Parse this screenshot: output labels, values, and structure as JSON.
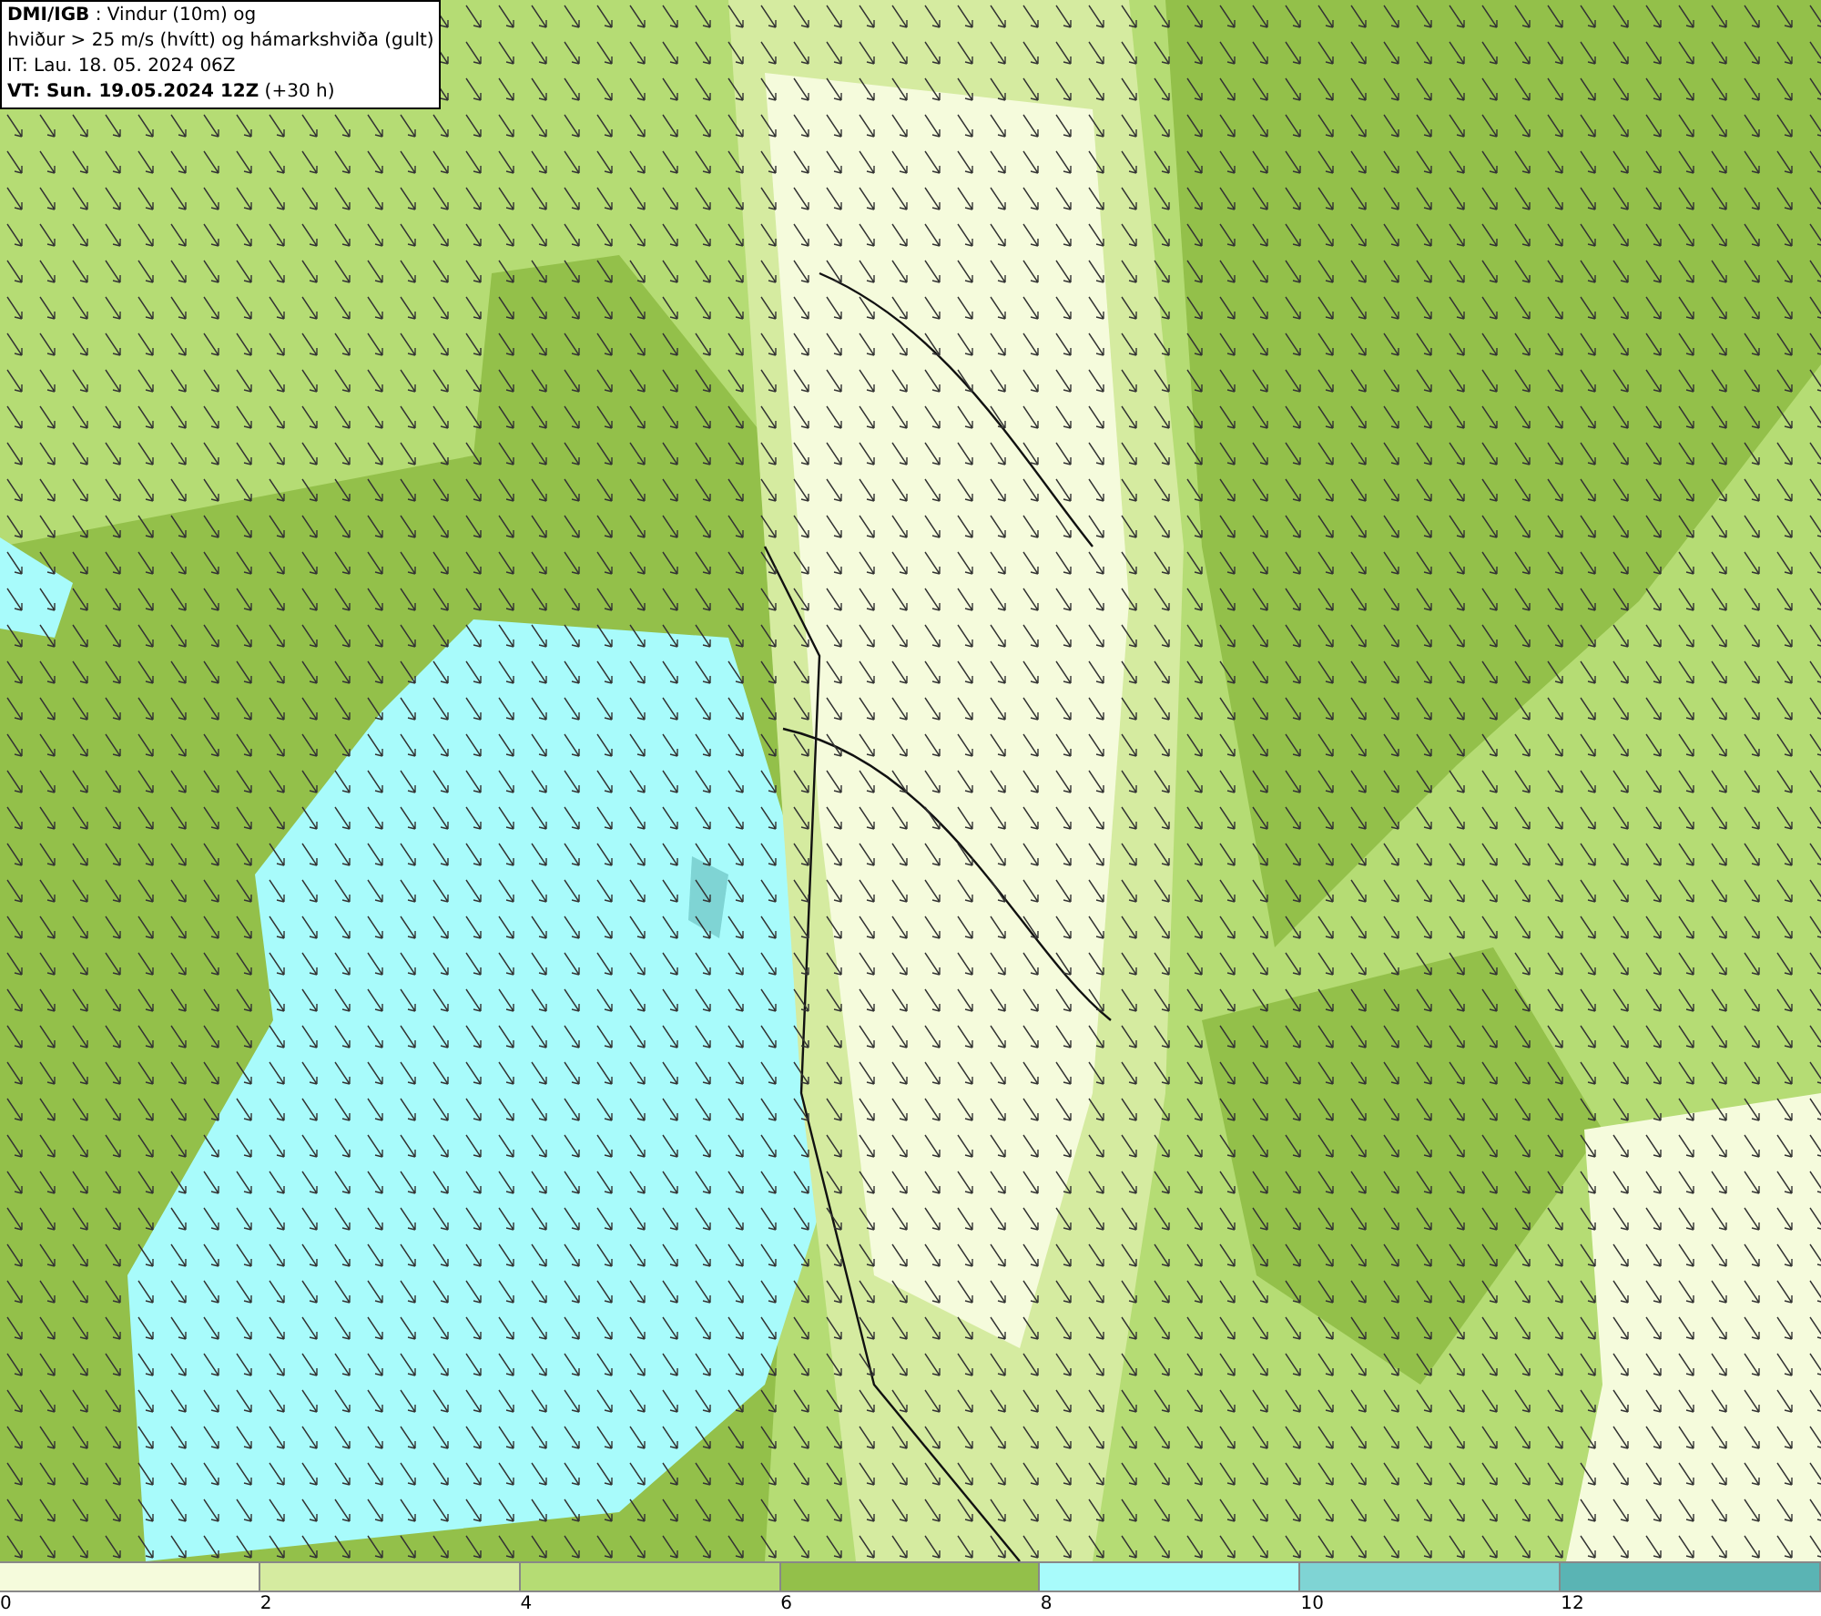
{
  "legend": {
    "lines": [
      "**DMI/IGB** : Vindur (10m) og",
      "hviður > 25 m/s (hvítt) og hámarkshviða (gult)",
      "IT: Lau. 18. 05. 2024 06Z",
      "**VT: Sun. 19.05.2024 12Z** (+30 h)"
    ]
  },
  "colorbar": [
    {
      "label": "0",
      "color": "#f5fbdc"
    },
    {
      "label": "2",
      "color": "#d5eba0"
    },
    {
      "label": "4",
      "color": "#b5dc74"
    },
    {
      "label": "6",
      "color": "#93c04a"
    },
    {
      "label": "8",
      "color": "#a8fbfb"
    },
    {
      "label": "10",
      "color": "#7fd4d4"
    },
    {
      "label": "12",
      "color": "#5ab4b4"
    }
  ]
}
